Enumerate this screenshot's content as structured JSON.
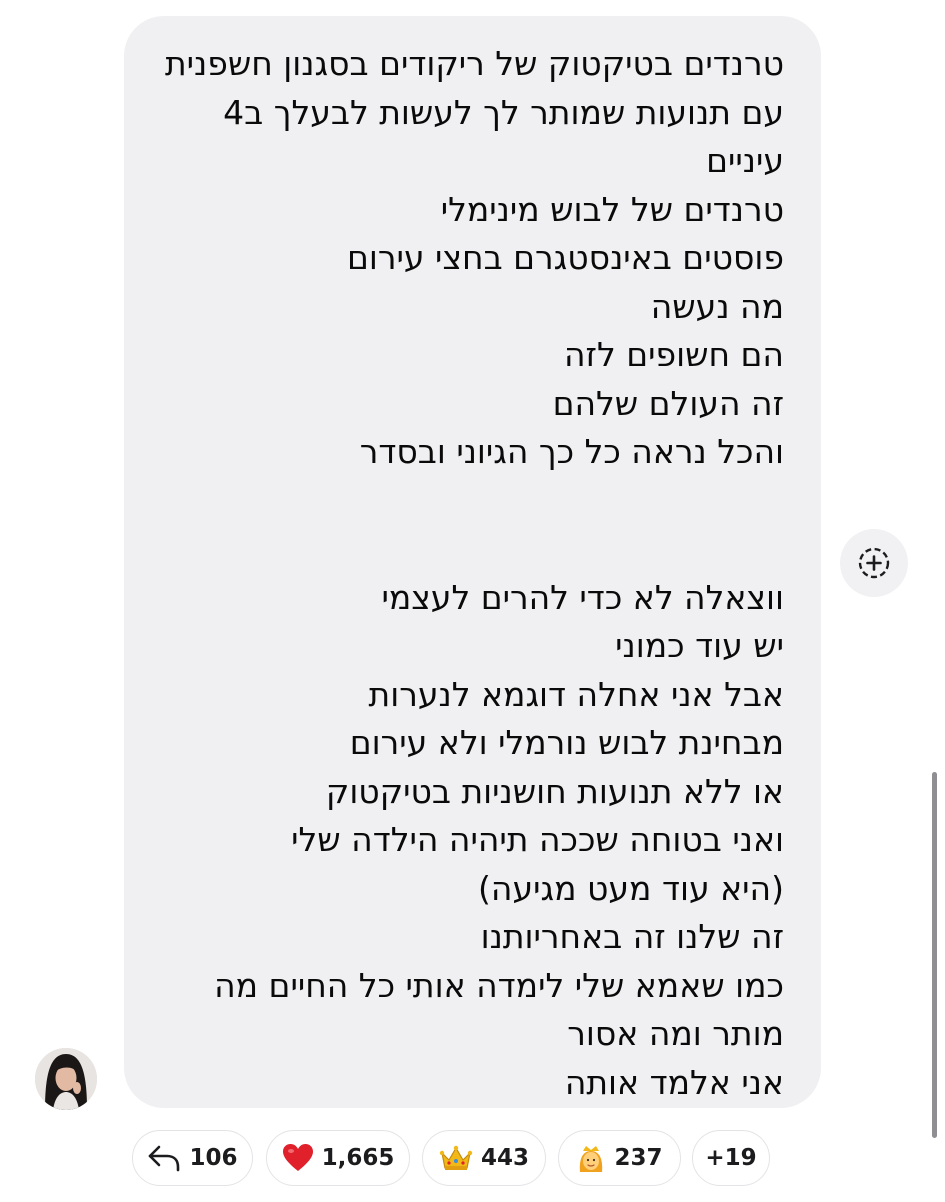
{
  "message": {
    "lines": [
      "טרנדים בטיקטוק של ריקודים בסגנון חשפנית",
      "עם תנועות שמותר לך לעשות לבעלך ב4",
      "עיניים",
      "טרנדים של לבוש מינימלי",
      "פוסטים באינסטגרם בחצי עירום",
      "מה נעשה",
      "הם חשופים לזה",
      "זה העולם שלהם",
      "והכל נראה כל כך הגיוני ובסדר",
      "",
      "",
      "ווצאלה לא כדי להרים לעצמי",
      "יש עוד כמוני",
      "אבל אני אחלה דוגמא לנערות",
      "מבחינת לבוש נורמלי ולא עירום",
      "או ללא תנועות חושניות בטיקטוק",
      "ואני בטוחה שככה תיהיה הילדה שלי",
      "(היא עוד מעט מגיעה)",
      "זה שלנו זה באחריותנו",
      "כמו שאמא שלי לימדה אותי כל החיים מה",
      "מותר ומה אסור",
      "אני אלמד אותה"
    ]
  },
  "reactions": [
    {
      "icon": "reply-arrow-icon",
      "count": "106"
    },
    {
      "icon": "red-heart-icon",
      "count": "1,665",
      "color": "#e0202b"
    },
    {
      "icon": "crown-icon",
      "count": "443",
      "color": "#f2b818"
    },
    {
      "icon": "princess-icon",
      "count": "237"
    },
    {
      "icon": "",
      "count": "+19"
    }
  ],
  "add_reaction": {
    "icon": "add-reaction-icon"
  }
}
